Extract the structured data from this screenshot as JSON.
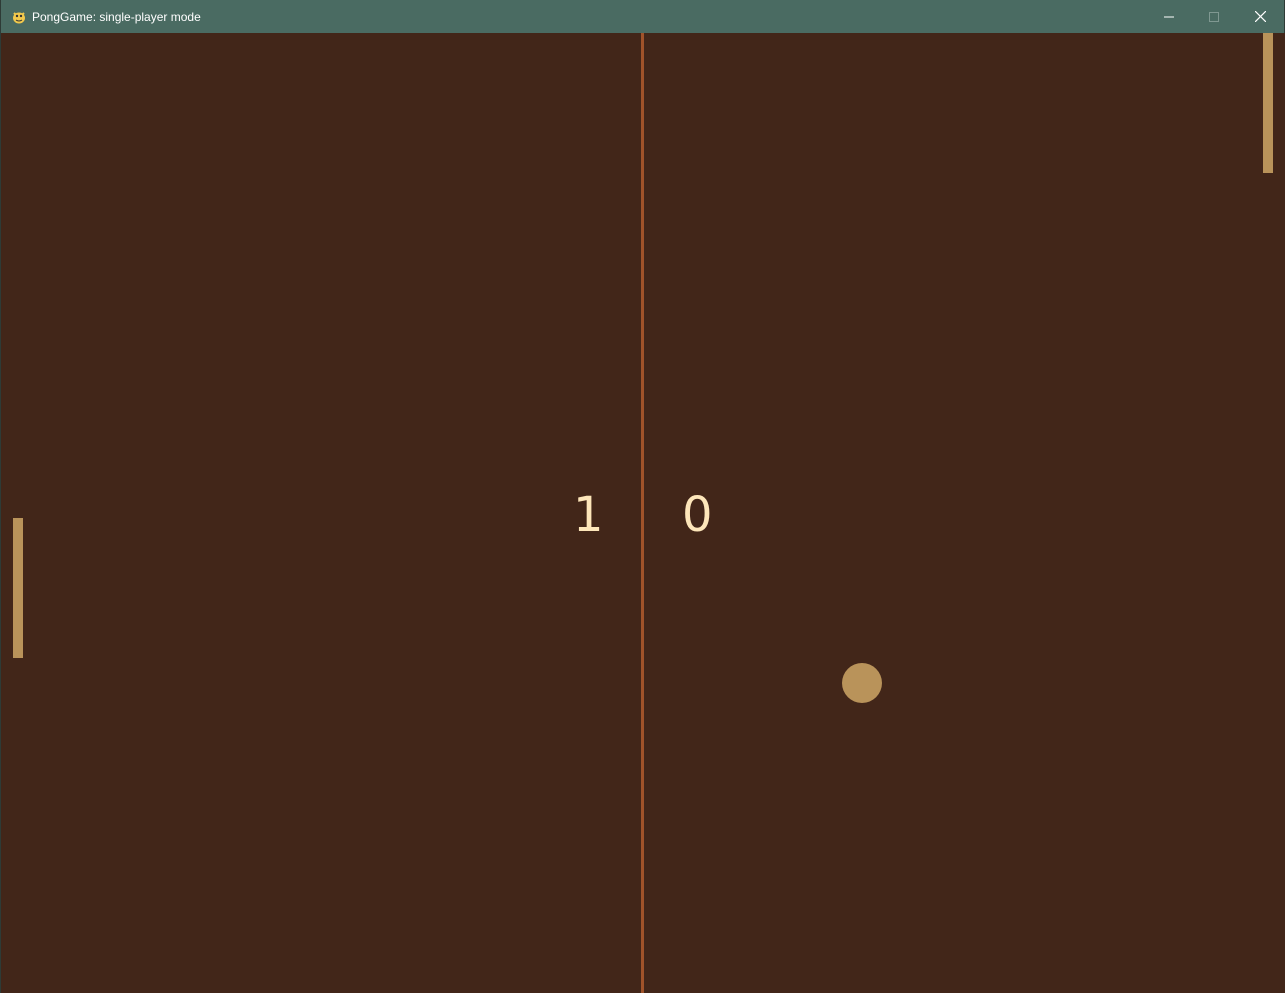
{
  "window": {
    "title": "PongGame: single-player mode",
    "icon": "python-snake-icon",
    "controls": [
      "minimize",
      "maximize",
      "close"
    ]
  },
  "game": {
    "score": {
      "left": "1",
      "right": "0"
    },
    "colors": {
      "background": "#422619",
      "center_line": "#a0532a",
      "paddle": "#b9935a",
      "ball": "#b9935a",
      "score_text": "#fde6ba",
      "titlebar": "#4a6b62"
    }
  }
}
